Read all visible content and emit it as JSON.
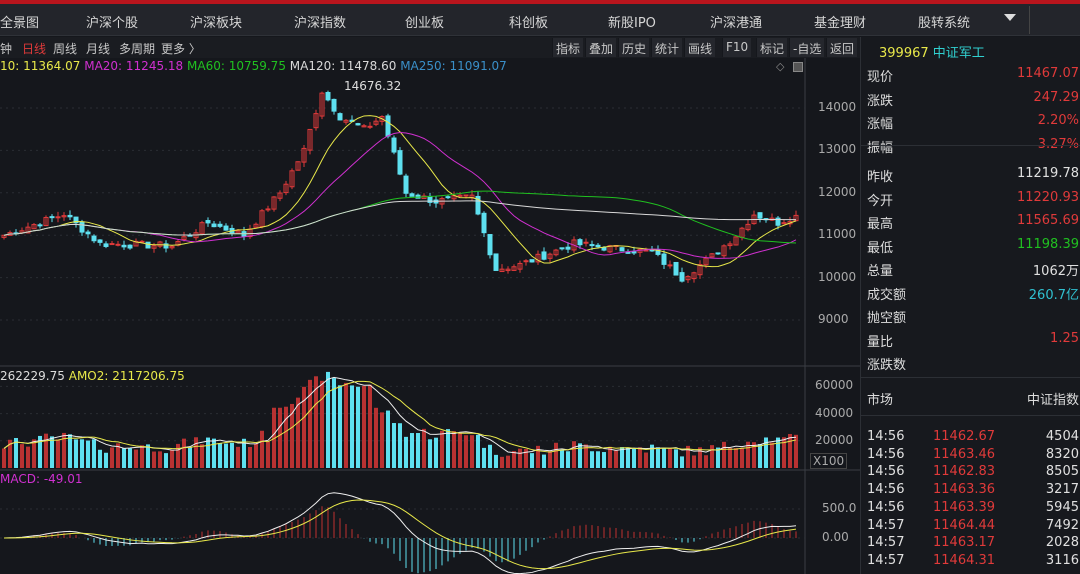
{
  "nav": {
    "items": [
      "全景图",
      "沪深个股",
      "沪深板块",
      "沪深指数",
      "创业板",
      "科创板",
      "新股IPO",
      "沪深港通",
      "基金理财",
      "股转系统"
    ]
  },
  "periods": [
    "钟",
    "日线",
    "周线",
    "月线",
    "多周期",
    "更多 〉"
  ],
  "tools": [
    "指标",
    "叠加",
    "历史",
    "统计",
    "画线",
    "F10",
    "标记",
    "-自选",
    "返回"
  ],
  "ma": {
    "ma10": "10: 11364.07",
    "ma20": "MA20: 11245.18",
    "ma60": "MA60: 10759.75",
    "ma120": "MA120: 11478.60",
    "ma250": "MA250: 11091.07"
  },
  "vol_label": {
    "amo1": "262229.75",
    "amo2": "AMO2: 2117206.75",
    "unit": "X100"
  },
  "macd_label": "MACD: -49.01",
  "peak_label": "14676.32",
  "colors": {
    "up": "#e03a3a",
    "down": "#5ee0f0",
    "ma10": "#e8e84a",
    "ma20": "#d030d0",
    "ma60": "#20c020",
    "ma120": "#d8d8d8",
    "ma250": "#3a8fc8"
  },
  "chart_data": {
    "type": "candlestick",
    "price_axis": {
      "ticks": [
        "14000",
        "13000",
        "12000",
        "11000",
        "10000",
        "9000"
      ],
      "range": [
        8400,
        15100
      ]
    },
    "volume_axis": {
      "ticks": [
        "60000",
        "40000",
        "20000"
      ],
      "range": [
        0,
        65000
      ]
    },
    "macd_axis": {
      "ticks": [
        "500.0",
        "0.00"
      ],
      "range": [
        -600,
        1000
      ]
    },
    "close_keypoints": [
      [
        0,
        11000
      ],
      [
        10,
        11500
      ],
      [
        16,
        10800
      ],
      [
        28,
        10750
      ],
      [
        34,
        11300
      ],
      [
        40,
        11000
      ],
      [
        46,
        12000
      ],
      [
        50,
        13000
      ],
      [
        53,
        14400
      ],
      [
        56,
        13800
      ],
      [
        60,
        13500
      ],
      [
        63,
        13800
      ],
      [
        67,
        12000
      ],
      [
        72,
        11800
      ],
      [
        78,
        11900
      ],
      [
        82,
        10200
      ],
      [
        86,
        10300
      ],
      [
        95,
        10800
      ],
      [
        101,
        10700
      ],
      [
        108,
        10600
      ],
      [
        113,
        10000
      ],
      [
        118,
        10500
      ],
      [
        122,
        11000
      ],
      [
        125,
        11500
      ],
      [
        129,
        11300
      ],
      [
        132,
        11467
      ]
    ],
    "peak": 14676.32
  },
  "quote": {
    "code": "399967",
    "name": "中证军工",
    "rows1": [
      {
        "k": "现价",
        "v": "11467.07",
        "c": "up"
      },
      {
        "k": "涨跌",
        "v": "247.29",
        "c": "up"
      },
      {
        "k": "涨幅",
        "v": "2.20%",
        "c": "up"
      },
      {
        "k": "振幅",
        "v": "3.27%",
        "c": "up"
      }
    ],
    "rows2": [
      {
        "k": "昨收",
        "v": "11219.78",
        "c": "w"
      },
      {
        "k": "今开",
        "v": "11220.93",
        "c": "up"
      },
      {
        "k": "最高",
        "v": "11565.69",
        "c": "up"
      },
      {
        "k": "最低",
        "v": "11198.39",
        "c": "dn"
      },
      {
        "k": "总量",
        "v": "1062万",
        "c": "w"
      },
      {
        "k": "成交额",
        "v": "260.7亿",
        "c": "cy"
      },
      {
        "k": "抛空额",
        "v": "",
        "c": "w"
      },
      {
        "k": "量比",
        "v": "1.25",
        "c": "up"
      },
      {
        "k": "涨跌数",
        "v": "",
        "c": "w"
      }
    ],
    "market_label": "市场",
    "market_value": "中证指数",
    "ticks": [
      [
        "14:56",
        "11462.67",
        "4504"
      ],
      [
        "14:56",
        "11463.46",
        "8320"
      ],
      [
        "14:56",
        "11462.83",
        "8505"
      ],
      [
        "14:56",
        "11463.36",
        "3217"
      ],
      [
        "14:56",
        "11463.39",
        "5945"
      ],
      [
        "14:57",
        "11464.44",
        "7492"
      ],
      [
        "14:57",
        "11463.17",
        "2028"
      ],
      [
        "14:57",
        "11464.31",
        "3116"
      ]
    ]
  }
}
